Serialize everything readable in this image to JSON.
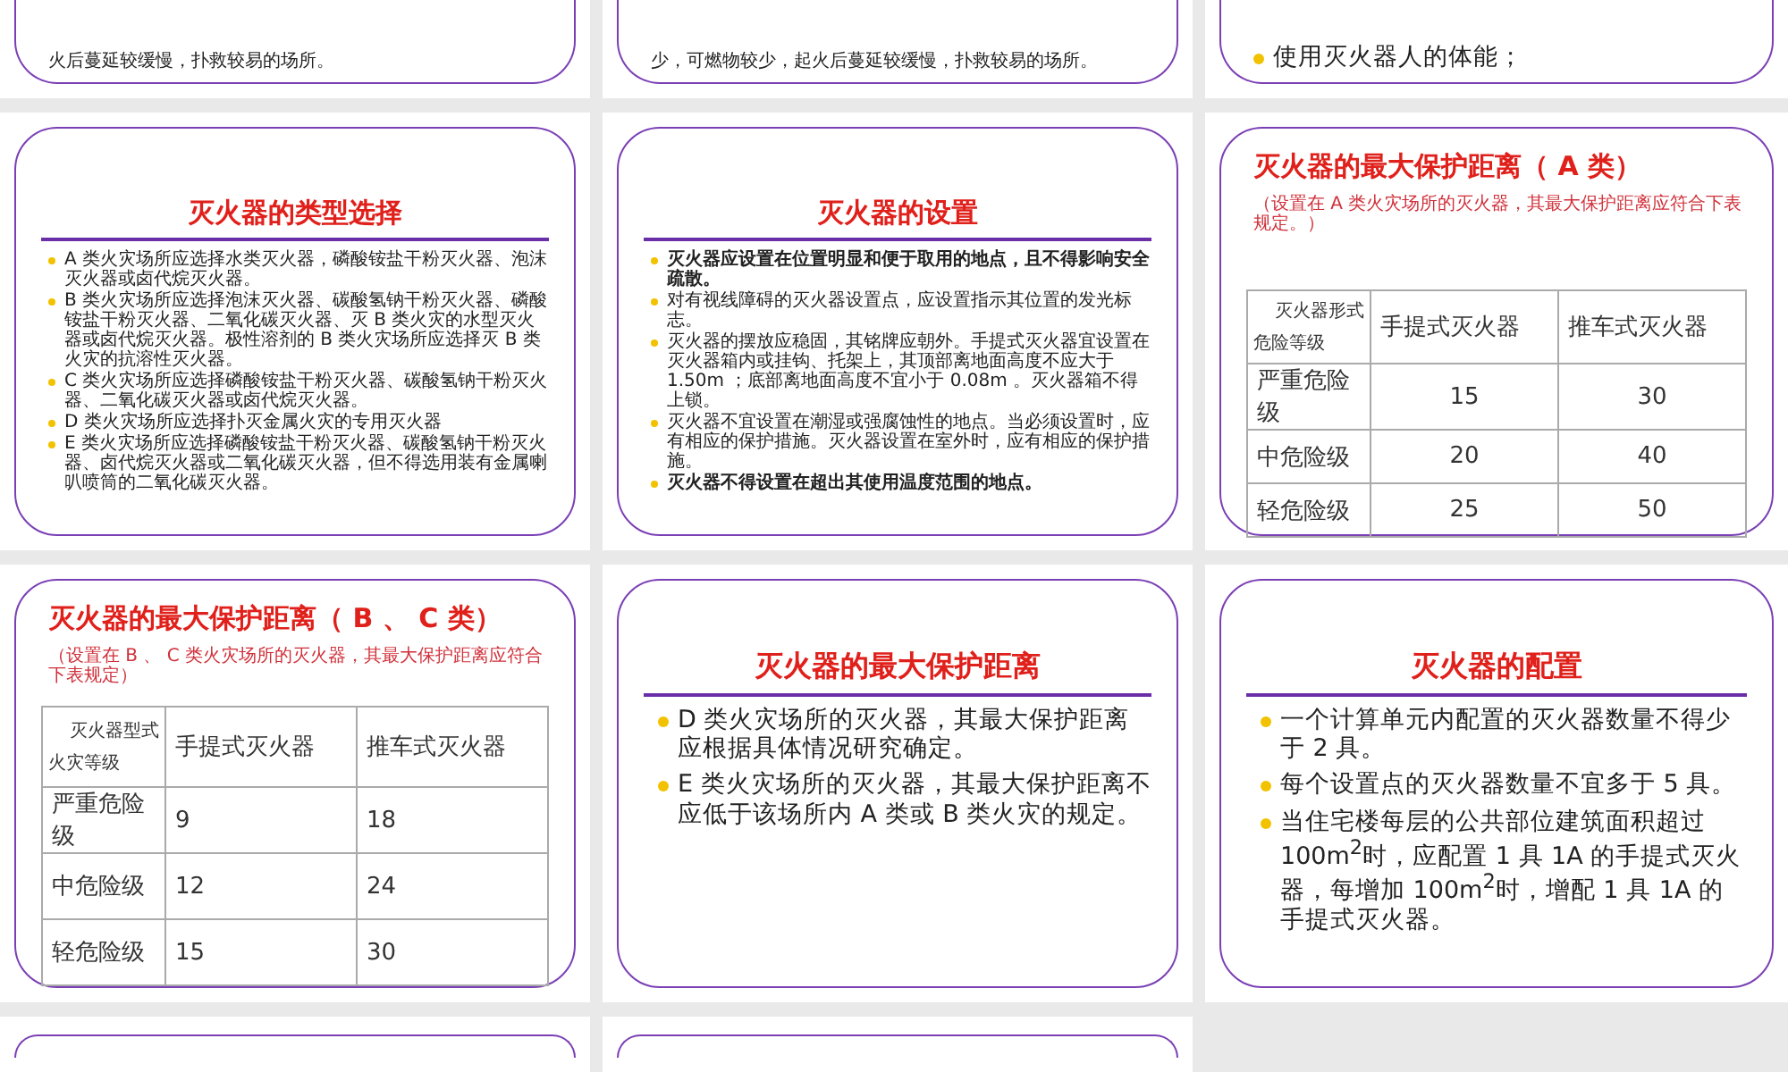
{
  "slides": [
    {
      "kind": "fragment",
      "items": [
        {
          "text": "火后蔓延较缓慢，扑救较易的场所。",
          "bullet": false
        }
      ]
    },
    {
      "kind": "fragment",
      "items": [
        {
          "text": "少，可燃物较少，起火后蔓延较缓慢，扑救较易的场所。",
          "bullet": false
        }
      ]
    },
    {
      "kind": "fragment-large",
      "items": [
        {
          "text": "使用灭火器人的体能；",
          "bullet": true
        }
      ]
    },
    {
      "kind": "bullets",
      "title": "灭火器的类型选择",
      "items": [
        {
          "text": "A 类火灾场所应选择水类灭火器，磷酸铵盐干粉灭火器、泡沫灭火器或卤代烷灭火器。"
        },
        {
          "text": "B 类火灾场所应选择泡沫灭火器、碳酸氢钠干粉灭火器、磷酸铵盐干粉灭火器、二氧化碳灭火器、灭 B 类火灾的水型灭火器或卤代烷灭火器。极性溶剂的 B 类火灾场所应选择灭 B 类火灾的抗溶性灭火器。"
        },
        {
          "text": "C 类火灾场所应选择磷酸铵盐干粉灭火器、碳酸氢钠干粉灭火器、二氧化碳灭火器或卤代烷灭火器。"
        },
        {
          "text": "D 类火灾场所应选择扑灭金属火灾的专用灭火器"
        },
        {
          "text": "E 类火灾场所应选择磷酸铵盐干粉灭火器、碳酸氢钠干粉灭火器、卤代烷灭火器或二氧化碳灭火器，但不得选用装有金属喇叭喷筒的二氧化碳灭火器。"
        }
      ]
    },
    {
      "kind": "bullets",
      "title": "灭火器的设置",
      "items": [
        {
          "text": "灭火器应设置在位置明显和便于取用的地点，且不得影响安全疏散。",
          "bold": true
        },
        {
          "text": "对有视线障碍的灭火器设置点，应设置指示其位置的发光标志。",
          "bold": false
        },
        {
          "text": "灭火器的摆放应稳固，其铭牌应朝外。手提式灭火器宜设置在灭火器箱内或挂钩、托架上，其顶部离地面高度不应大于 1.50m ；底部离地面高度不宜小于 0.08m 。灭火器箱不得上锁。",
          "bold": false
        },
        {
          "text": "灭火器不宜设置在潮湿或强腐蚀性的地点。当必须设置时，应有相应的保护措施。灭火器设置在室外时，应有相应的保护措施。",
          "bold": false
        },
        {
          "text": "灭火器不得设置在超出其使用温度范围的地点。",
          "bold": true
        }
      ]
    },
    {
      "kind": "centered-table",
      "title": "灭火器的最大保护距离（ A 类）",
      "note": "（设置在 A 类火灾场所的灭火器，其最大保护距离应符合下表规定。）",
      "corner_top": "灭火器形式",
      "corner_bottom": "危险等级",
      "columns": [
        "",
        "手提式灭火器",
        "推车式灭火器"
      ],
      "rows": [
        [
          "严重危险级",
          "15",
          "30"
        ],
        [
          "中危险级",
          "20",
          "40"
        ],
        [
          "轻危险级",
          "25",
          "50"
        ]
      ]
    },
    {
      "kind": "left-table",
      "title": "灭火器的最大保护距离（ B 、 C 类）",
      "note": "（设置在 B 、 C 类火灾场所的灭火器，其最大保护距离应符合下表规定）",
      "corner_top": "灭火器型式",
      "corner_bottom": "火灾等级",
      "columns": [
        "",
        "手提式灭火器",
        "推车式灭火器"
      ],
      "rows": [
        [
          "严重危险级",
          "9",
          "18"
        ],
        [
          "中危险级",
          "12",
          "24"
        ],
        [
          "轻危险级",
          "15",
          "30"
        ]
      ]
    },
    {
      "kind": "large-bullets",
      "title": "灭火器的最大保护距离",
      "items": [
        {
          "text": "D 类火灾场所的灭火器，其最大保护距离应根据具体情况研究确定。"
        },
        {
          "text": "E 类火灾场所的灭火器，其最大保护距离不应低于该场所内 A 类或 B 类火灾的规定。"
        }
      ]
    },
    {
      "kind": "large-bullets",
      "title": "灭火器的配置",
      "items": [
        {
          "text": "一个计算单元内配置的灭火器数量不得少于 2 具。"
        },
        {
          "text": "每个设置点的灭火器数量不宜多于 5 具。"
        },
        {
          "text": "当住宅楼每层的公共部位建筑面积超过 100m$^{2}$时，应配置 1 具 1A 的手提式灭火器，每增加 100m$^{2}$时，增配 1 具 1A 的手提式灭火器。"
        }
      ]
    },
    {
      "kind": "blank"
    },
    {
      "kind": "blank"
    }
  ]
}
